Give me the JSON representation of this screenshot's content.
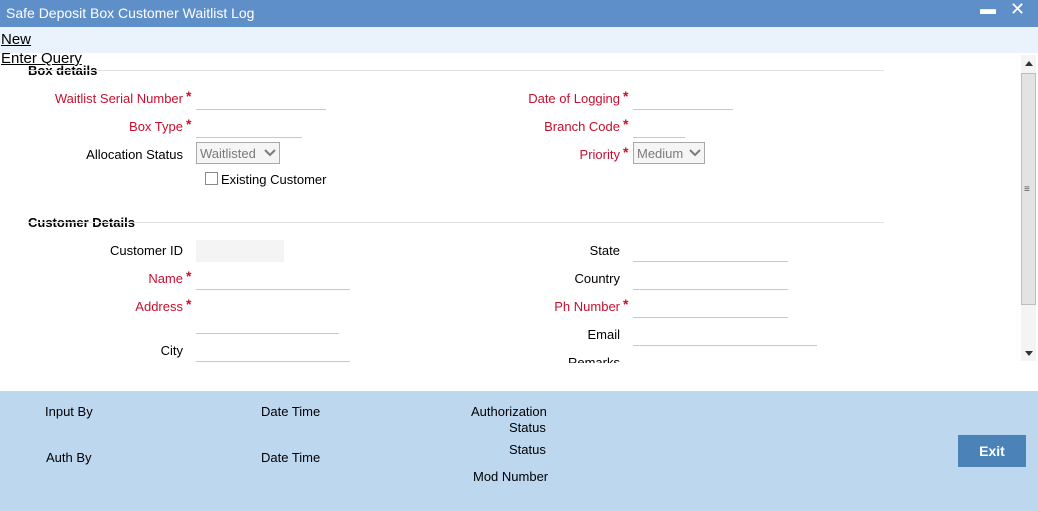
{
  "window": {
    "title": "Safe Deposit Box Customer Waitlist Log",
    "minimize_glyph": "▬",
    "close_glyph": "✕"
  },
  "menu": {
    "new_label": "New",
    "enter_query_label": "Enter Query"
  },
  "box_details": {
    "section_title": "Box details",
    "waitlist_serial_number": {
      "label": "Waitlist Serial Number",
      "value": ""
    },
    "date_of_logging": {
      "label": "Date of Logging",
      "value": ""
    },
    "box_type": {
      "label": "Box Type",
      "value": ""
    },
    "branch_code": {
      "label": "Branch Code",
      "value": ""
    },
    "allocation_status": {
      "label": "Allocation Status",
      "selected": "Waitlisted"
    },
    "priority": {
      "label": "Priority",
      "selected": "Medium"
    },
    "existing_customer": {
      "label": "Existing Customer",
      "checked": false
    }
  },
  "customer_details": {
    "section_title": "Customer Details",
    "customer_id": {
      "label": "Customer ID",
      "value": ""
    },
    "state": {
      "label": "State",
      "value": ""
    },
    "name": {
      "label": "Name",
      "value": ""
    },
    "country": {
      "label": "Country",
      "value": ""
    },
    "address": {
      "label": "Address",
      "value": ""
    },
    "ph_number": {
      "label": "Ph Number",
      "value": ""
    },
    "email": {
      "label": "Email",
      "value": ""
    },
    "city": {
      "label": "City",
      "value": ""
    },
    "remarks": {
      "label": "Remarks",
      "value": ""
    }
  },
  "required_marker": "*",
  "footer": {
    "input_by": "Input By",
    "date_time_1": "Date Time",
    "authorization_status_line1": "Authorization",
    "authorization_status_line2": "Status",
    "auth_by": "Auth By",
    "date_time_2": "Date Time",
    "status": "Status",
    "mod_number": "Mod Number",
    "exit_label": "Exit"
  },
  "colors": {
    "title_bar": "#5f8fc8",
    "footer": "#bdd7ef",
    "required_label": "#c8102e",
    "exit_button": "#4b82b8"
  }
}
